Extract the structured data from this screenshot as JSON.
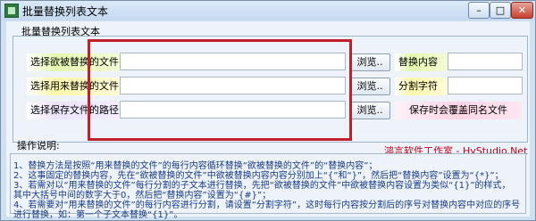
{
  "window": {
    "title": "批量替换列表文本",
    "minimize": "–",
    "maximize": "□",
    "close": "✕"
  },
  "group": {
    "title": "批量替换列表文本"
  },
  "rows": [
    {
      "label": "选择欲被替换的文件",
      "browse": "浏览..",
      "right_label": "替换内容"
    },
    {
      "label": "选择用来替换的文件",
      "browse": "浏览..",
      "right_label": "分割字符"
    },
    {
      "label": "选择保存文件的路径",
      "browse": "浏览..",
      "right_label": "保存时会覆盖同名文件"
    }
  ],
  "right_inputs": {
    "replace_content": "",
    "split_char": ""
  },
  "inputs": {
    "file1": "",
    "file2": "",
    "save_path": ""
  },
  "ops": {
    "title": "操作说明:",
    "credit": "鸿言软件工作室 - HyStudio.Net",
    "lines": [
      "1、替换方法是按照“用来替换的文件”的每行内容循环替换“欲被替换的文件”的“替换内容”；",
      "2、这事固定的替换内容，先在“欲被替换的文件”中欲被替换内容内容分别加上“{”和“}”，然后把“替换内容”设置为“{*}”；",
      "3、若需对以“用来替换的文件”每行分割的子文本进行替换，先把“欲被替换的文件”中欲被替换内容设置为类似“{1}”的样式，",
      "其中大括号中间的数字大于0，然后把“替换内容”设置为“{#}”；",
      "4、若需要对“用来替换的文件”的每行内容进行分割，请设置“分割字符”，这时每行内容按分割后的序号对替换内容中对应的序号",
      "进行替换，如：第一个子文本替换“{1}”。"
    ]
  },
  "colors": {
    "highlight": "#c0202a",
    "credit": "#c0001e",
    "instructions": "#163a8c"
  }
}
